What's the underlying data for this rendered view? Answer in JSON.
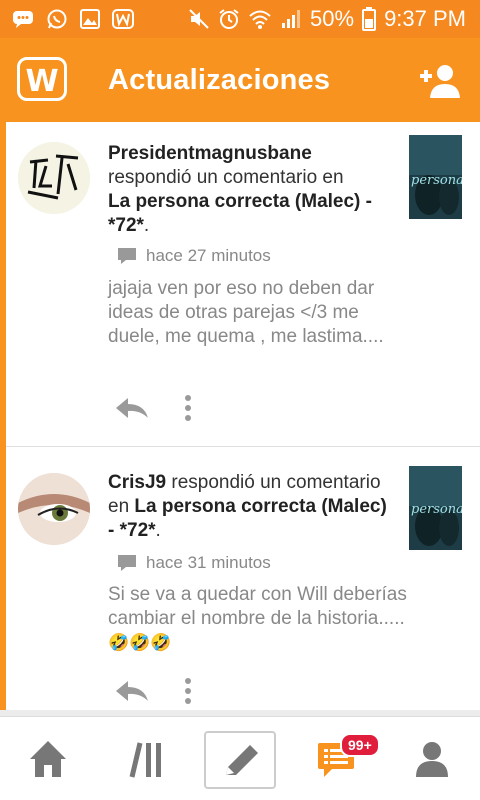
{
  "status_bar": {
    "battery": "50%",
    "time": "9:37 PM"
  },
  "app_bar": {
    "logo": "W",
    "title": "Actualizaciones"
  },
  "feed": [
    {
      "user": "Presidentmagnusbane",
      "action": "respondió un comentario en",
      "story": "La persona correcta (Malec) - *72*",
      "trailing": ".",
      "time": "hace 27 minutos",
      "comment": "jajaja ven por eso no deben dar ideas de otras parejas </3 me duele, me quema , me lastima....",
      "thumb_text": "persona"
    },
    {
      "user": "CrisJ9",
      "action": "respondió un comentario en",
      "story": "La persona correcta (Malec) - *72*",
      "trailing": ".",
      "time": "hace 31 minutos",
      "comment": "Si se va a quedar con Will deberías cambiar el nombre de la historia.....",
      "emoji": "🤣🤣🤣",
      "thumb_text": "persona"
    }
  ],
  "bottom_nav": {
    "badge": "99+"
  },
  "colors": {
    "brand": "#f7931e",
    "badge": "#e01e3c"
  }
}
